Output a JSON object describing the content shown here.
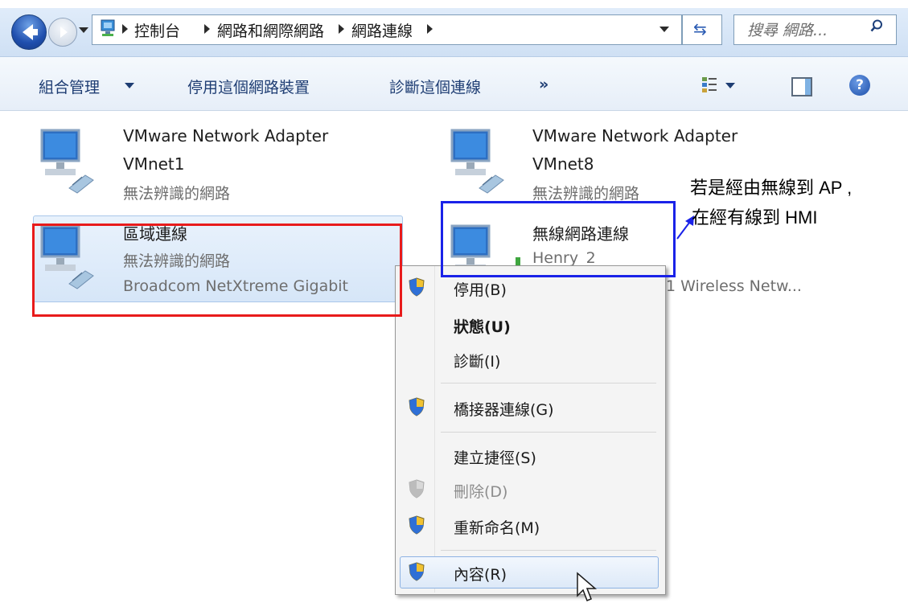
{
  "address_bar": {
    "breadcrumbs": [
      "控制台",
      "網路和網際網路",
      "網路連線"
    ],
    "search_placeholder": "搜尋 網路..."
  },
  "command_bar": {
    "organize": "組合管理",
    "disable_device": "停用這個網路裝置",
    "diagnose": "診斷這個連線",
    "more": "»"
  },
  "connections": [
    {
      "name_line1": "VMware Network Adapter",
      "name_line2": "VMnet1",
      "status": "無法辨識的網路"
    },
    {
      "name_line1": "VMware Network Adapter",
      "name_line2": "VMnet8",
      "status": "無法辨識的網路"
    },
    {
      "name": "區域連線",
      "status": "無法辨識的網路",
      "device": "Broadcom NetXtreme Gigabit",
      "selected": true
    },
    {
      "name": "無線網路連線",
      "status": "Henry_2",
      "device": "1 Wireless Netw..."
    }
  ],
  "context_menu": {
    "items": [
      {
        "label": "停用(B)",
        "shield": true
      },
      {
        "label": "狀態(U)",
        "bold": true
      },
      {
        "label": "診斷(I)"
      },
      {
        "label": "橋接器連線(G)",
        "shield": true
      },
      {
        "label": "建立捷徑(S)"
      },
      {
        "label": "刪除(D)",
        "shield": true,
        "disabled": true
      },
      {
        "label": "重新命名(M)",
        "shield": true
      },
      {
        "label": "內容(R)",
        "shield": true,
        "highlighted": true
      }
    ]
  },
  "annotation": {
    "line1": "若是經由無線到 AP ,",
    "line2": "在經有線到 HMI",
    "red_box_color": "#e81b1b",
    "blue_box_color": "#1a22e8"
  }
}
